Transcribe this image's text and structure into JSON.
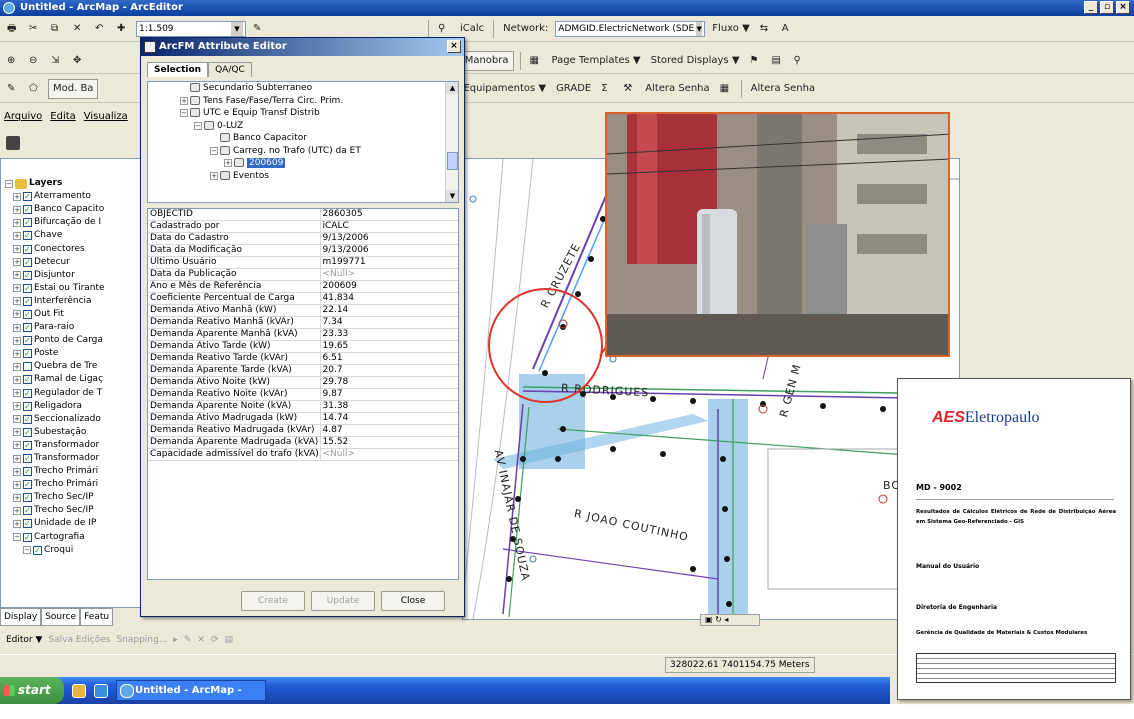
{
  "window": {
    "title": "Untitled - ArcMap - ArcEditor"
  },
  "toolbar1": {
    "scale": "1:1.509",
    "icalc": "iCalc",
    "network_label": "Network:",
    "network_value": "ADMGID.ElectricNetwork (SDE",
    "fluxo": "Fluxo ▼",
    "extra": "A"
  },
  "toolbar2": {
    "feeder": "Feeder Manobra",
    "page_templates": "Page Templates ▼",
    "stored_displays": "Stored Displays ▼"
  },
  "toolbar3": {
    "mod": "Mod. Ba",
    "equipamentos": "Equipamentos ▼",
    "grade": "GRADE",
    "altera_senha_1": "Altera Senha",
    "altera_senha_2": "Altera Senha"
  },
  "menu": {
    "items": [
      "Arquivo",
      "Edita",
      "Visualiza"
    ]
  },
  "toc": {
    "root": "Layers",
    "layers": [
      "Aterramento",
      "Banco Capacito",
      "Bifurcação de I",
      "Chave",
      "Conectores",
      "Detecur",
      "Disjuntor",
      "Estai ou Tirante",
      "Interferência",
      "Out Fit",
      "Para-raio",
      "Ponto de Carga",
      "Poste",
      "Quebra de Tre",
      "Ramal de Ligaç",
      "Regulador de T",
      "Religadora",
      "Seccionalizado",
      "Subestação",
      "Transformador",
      "Transformador",
      "Trecho Primári",
      "Trecho Primári",
      "Trecho Sec/IP",
      "Trecho Sec/IP",
      "Unidade de IP",
      "Cartografia",
      "Croqui"
    ],
    "tabs": [
      "Display",
      "Source",
      "Featu"
    ]
  },
  "editor_bar": {
    "editor": "Editor ▼",
    "salva": "Salva Edições",
    "snapping": "Snapping..."
  },
  "status": {
    "coords": "328022.61  7401154.75 Meters"
  },
  "taskbar": {
    "start": "start",
    "task": "Untitled - ArcMap - Ar..."
  },
  "dialog": {
    "title": "ArcFM Attribute Editor",
    "tabs": [
      "Selection",
      "QA/QC"
    ],
    "tree": [
      "Secundario Subterraneo",
      "Tens Fase/Fase/Terra Circ. Prim.",
      "UTC e Equip Transf Distrib",
      "0-LUZ",
      "Banco Capacitor",
      "Carreg. no Trafo (UTC) da ET",
      "200609",
      "Eventos"
    ],
    "attributes": [
      {
        "k": "OBJECTID",
        "v": "2860305"
      },
      {
        "k": "Cadastrado por",
        "v": "iCALC"
      },
      {
        "k": "Data do Cadastro",
        "v": "9/13/2006"
      },
      {
        "k": "Data da Modificação",
        "v": "9/13/2006"
      },
      {
        "k": "Último Usuário",
        "v": "m199771"
      },
      {
        "k": "Data da Publicação",
        "v": "<Null>"
      },
      {
        "k": "Ano e Mês de Referência",
        "v": "200609"
      },
      {
        "k": "Coeficiente Percentual de Carga",
        "v": "41.834"
      },
      {
        "k": "Demanda Ativo Manhã (kW)",
        "v": "22.14"
      },
      {
        "k": "Demanda Reativo Manhã (kVAr)",
        "v": "7.34"
      },
      {
        "k": "Demanda Aparente Manhã (kVA)",
        "v": "23.33"
      },
      {
        "k": "Demanda Ativo Tarde (kW)",
        "v": "19.65"
      },
      {
        "k": "Demanda Reativo Tarde (kVAr)",
        "v": "6.51"
      },
      {
        "k": "Demanda Aparente Tarde (kVA)",
        "v": "20.7"
      },
      {
        "k": "Demanda Ativo Noite (kW)",
        "v": "29.78"
      },
      {
        "k": "Demanda Reativo  Noite (kVAr)",
        "v": "9.87"
      },
      {
        "k": "Demanda Aparente Noite (kVA)",
        "v": "31.38"
      },
      {
        "k": "Demanda Ativo Madrugada (kW)",
        "v": "14.74"
      },
      {
        "k": "Demanda Reativo  Madrugada (kVAr)",
        "v": "4.87"
      },
      {
        "k": "Demanda Aparente Madrugada (kVA)",
        "v": "15.52"
      },
      {
        "k": "Capacidade admissível do trafo (kVA)",
        "v": "<Null>"
      }
    ],
    "buttons": {
      "create": "Create",
      "update": "Update",
      "close": "Close"
    }
  },
  "map": {
    "streets": [
      "R CRUZETE",
      "R RODRIGUES",
      "R GEN M",
      "R JOAO COUTINHO",
      "AV INAJAR DE SOUZA",
      "BO"
    ]
  },
  "document": {
    "logo_mark": "AES",
    "logo_text": "Eletropaulo",
    "doc_no": "MD - 9002",
    "title": "Resultados de Cálculos Elétricos de Rede de Distribuição Aérea em Sistema Geo-Referenciado - GIS",
    "manual": "Manual do Usuário",
    "directorate": "Diretoria de Engenharia",
    "management": "Gerência de Qualidade de Materiais & Custos Modulares"
  },
  "colors": {
    "title_blue": "#0a3e9e",
    "callout_red": "#e0332a",
    "photo_border": "#d9622a",
    "map_highlight": "#6fb3e0"
  }
}
